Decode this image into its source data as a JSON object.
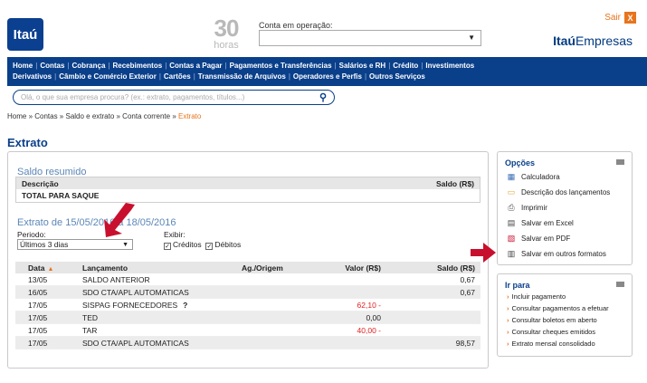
{
  "header": {
    "logo": "Itaú",
    "hours_big": "30",
    "hours_small": "horas",
    "conta_label": "Conta em operação:",
    "conta_value": "",
    "sair": "Sair",
    "sair_icon": "X",
    "brand_bold": "Itaú",
    "brand_rest": "Empresas"
  },
  "nav": {
    "row1": [
      "Home",
      "Contas",
      "Cobrança",
      "Recebimentos",
      "Contas a Pagar",
      "Pagamentos e Transferências",
      "Salários e RH",
      "Crédito",
      "Investimentos"
    ],
    "row2": [
      "Derivativos",
      "Câmbio e Comércio Exterior",
      "Cartões",
      "Transmissão de Arquivos",
      "Operadores e Perfis",
      "Outros Serviços"
    ]
  },
  "search": {
    "placeholder": "Olá, o que sua empresa procura? (ex.: extrato, pagamentos, títulos...)"
  },
  "breadcrumb": {
    "path": "Home » Contas » Saldo e extrato » Conta corrente » ",
    "current": "Extrato"
  },
  "page_title": "Extrato",
  "saldo": {
    "title": "Saldo resumido",
    "col_desc": "Descrição",
    "col_saldo": "Saldo (R$)",
    "row_label": "TOTAL PARA SAQUE"
  },
  "extrato": {
    "title": "Extrato de 15/05/2016 a 18/05/2016",
    "periodo_label": "Periodo:",
    "periodo_value": "Últimos 3 dias",
    "exibir_label": "Exibir:",
    "creditos": "Créditos",
    "debitos": "Débitos"
  },
  "tx": {
    "headers": {
      "data": "Data",
      "lancamento": "Lançamento",
      "ag": "Ag./Origem",
      "valor": "Valor (R$)",
      "saldo": "Saldo (R$)"
    },
    "rows": [
      {
        "data": "13/05",
        "lancamento": "SALDO ANTERIOR",
        "valor": "",
        "saldo": "0,67",
        "neg": false,
        "help": ""
      },
      {
        "data": "16/05",
        "lancamento": "SDO CTA/APL AUTOMATICAS",
        "valor": "",
        "saldo": "0,67",
        "neg": false,
        "help": ""
      },
      {
        "data": "17/05",
        "lancamento": "SISPAG FORNECEDORES",
        "valor": "62,10 -",
        "saldo": "",
        "neg": true,
        "help": "?"
      },
      {
        "data": "17/05",
        "lancamento": "TED",
        "valor": "0,00",
        "saldo": "",
        "neg": false,
        "help": ""
      },
      {
        "data": "17/05",
        "lancamento": "TAR",
        "valor": "40,00 -",
        "saldo": "",
        "neg": true,
        "help": ""
      },
      {
        "data": "17/05",
        "lancamento": "SDO CTA/APL AUTOMATICAS",
        "valor": "",
        "saldo": "98,57",
        "neg": false,
        "help": ""
      }
    ]
  },
  "opcoes": {
    "title": "Opções",
    "items": [
      {
        "label": "Calculadora",
        "icon": "calculator-icon"
      },
      {
        "label": "Descrição dos lançamentos",
        "icon": "document-icon"
      },
      {
        "label": "Imprimir",
        "icon": "printer-icon"
      },
      {
        "label": "Salvar em Excel",
        "icon": "save-excel-icon"
      },
      {
        "label": "Salvar em PDF",
        "icon": "pdf-icon"
      },
      {
        "label": "Salvar em outros formatos",
        "icon": "save-icon"
      }
    ]
  },
  "irpara": {
    "title": "Ir para",
    "items": [
      "Incluir pagamento",
      "Consultar pagamentos a efetuar",
      "Consultar boletos em aberto",
      "Consultar cheques emitidos",
      "Extrato mensal consolidado"
    ]
  },
  "colors": {
    "brand": "#0a3f8a",
    "accent": "#e8741c",
    "negative": "#e02020"
  }
}
